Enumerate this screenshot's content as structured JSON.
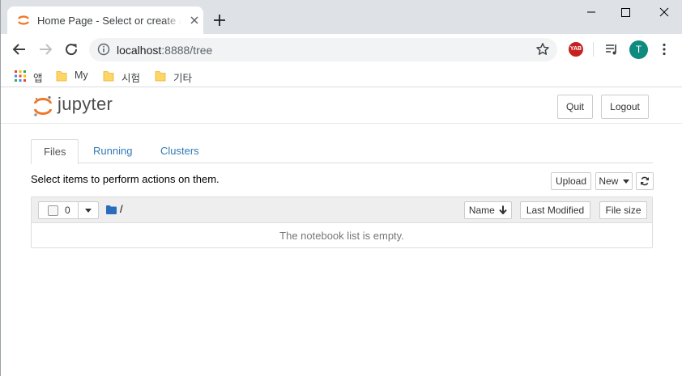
{
  "browser": {
    "tab_title": "Home Page - Select or create a notebook",
    "url_host": "localhost",
    "url_rest": ":8888/tree",
    "avatar_letter": "T",
    "extension_label": "YAB",
    "bookmarks": [
      {
        "label": "앱",
        "icon": "apps-grid-icon"
      },
      {
        "label": "My",
        "icon": "folder-icon"
      },
      {
        "label": "시험",
        "icon": "folder-icon"
      },
      {
        "label": "기타",
        "icon": "folder-icon"
      }
    ]
  },
  "jupyter": {
    "wordmark": "jupyter",
    "quit_label": "Quit",
    "logout_label": "Logout",
    "tabs": [
      {
        "label": "Files",
        "active": true
      },
      {
        "label": "Running",
        "active": false
      },
      {
        "label": "Clusters",
        "active": false
      }
    ],
    "instructions": "Select items to perform actions on them.",
    "upload_label": "Upload",
    "new_label": "New",
    "selected_count": "0",
    "breadcrumb": "/",
    "columns": {
      "name": "Name",
      "last_modified": "Last Modified",
      "file_size": "File size"
    },
    "empty_message": "The notebook list is empty."
  },
  "colors": {
    "jupyter_orange": "#f37726",
    "link_blue": "#337ab7",
    "folder_blue": "#2a6ebb",
    "avatar_teal": "#0f8a7e"
  }
}
